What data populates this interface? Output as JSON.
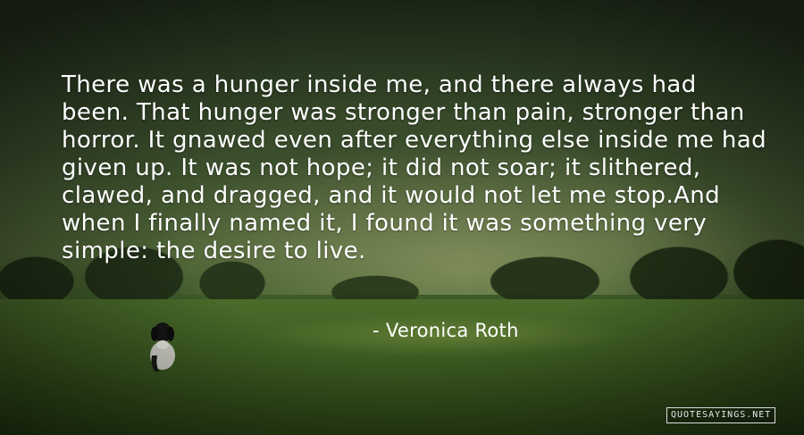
{
  "quote": {
    "text": "There was a hunger inside me, and there always had been. That hunger was stronger than pain, stronger than horror. It gnawed even after everything else inside me had given up. It was not hope; it did not soar; it slithered, clawed, and dragged, and it would not let me stop.And when I finally named it, I found it was something very simple: the desire to live.",
    "author": "- Veronica Roth"
  },
  "watermark": "QUOTESAYINGS.NET",
  "colors": {
    "text": "#ffffff",
    "field": "#3e5e22",
    "trees": "#1f2d16"
  }
}
